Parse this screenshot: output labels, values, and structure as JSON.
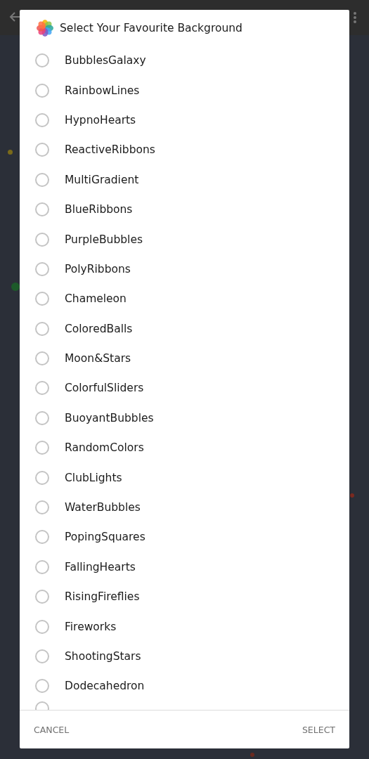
{
  "dialog": {
    "title": "Select Your Favourite Background",
    "options": [
      {
        "label": "BubblesGalaxy",
        "selected": false
      },
      {
        "label": "RainbowLines",
        "selected": false
      },
      {
        "label": "HypnoHearts",
        "selected": false
      },
      {
        "label": "ReactiveRibbons",
        "selected": false
      },
      {
        "label": "MultiGradient",
        "selected": false
      },
      {
        "label": "BlueRibbons",
        "selected": false
      },
      {
        "label": "PurpleBubbles",
        "selected": false
      },
      {
        "label": "PolyRibbons",
        "selected": false
      },
      {
        "label": "Chameleon",
        "selected": false
      },
      {
        "label": "ColoredBalls",
        "selected": false
      },
      {
        "label": "Moon&Stars",
        "selected": false
      },
      {
        "label": "ColorfulSliders",
        "selected": false
      },
      {
        "label": "BuoyantBubbles",
        "selected": false
      },
      {
        "label": "RandomColors",
        "selected": false
      },
      {
        "label": "ClubLights",
        "selected": false
      },
      {
        "label": "WaterBubbles",
        "selected": false
      },
      {
        "label": "PopingSquares",
        "selected": false
      },
      {
        "label": "FallingHearts",
        "selected": false
      },
      {
        "label": "RisingFireflies",
        "selected": false
      },
      {
        "label": "Fireworks",
        "selected": false
      },
      {
        "label": "ShootingStars",
        "selected": false
      },
      {
        "label": "Dodecahedron",
        "selected": false
      }
    ],
    "partial_option": {
      "selected": false
    },
    "buttons": [
      "CANCEL",
      "SELECT"
    ]
  }
}
